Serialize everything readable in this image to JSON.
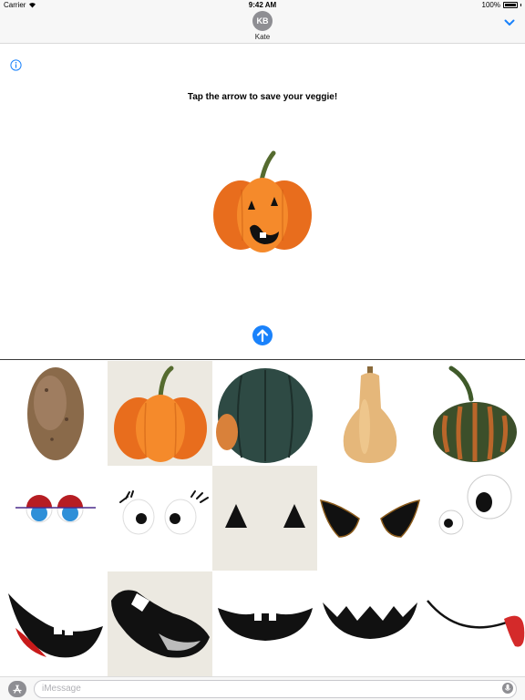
{
  "status_bar": {
    "carrier": "Carrier",
    "time": "9:42 AM",
    "battery": "100%"
  },
  "header": {
    "avatar_initials": "KB",
    "contact_name": "Kate"
  },
  "composer": {
    "instruction": "Tap the arrow to save your veggie!"
  },
  "grid": {
    "rows": [
      [
        "potato",
        "pumpkin",
        "acorn-squash",
        "butternut-squash",
        "striped-gourd"
      ],
      [
        "red-lidded-eyes",
        "lashed-eyes",
        "triangle-eyes",
        "angry-eyes",
        "googly-eyes"
      ],
      [
        "tongue-mouth",
        "buck-tooth-mouth",
        "jack-o-lantern-mouth",
        "zigzag-mouth",
        "smile-tongue-mouth"
      ]
    ],
    "selected": [
      "pumpkin",
      "triangle-eyes",
      "buck-tooth-mouth"
    ]
  },
  "compose": {
    "placeholder": "iMessage"
  },
  "colors": {
    "ios_blue": "#1a82fb",
    "selection_bg": "#ece9e1",
    "pumpkin": "#f07a22"
  }
}
